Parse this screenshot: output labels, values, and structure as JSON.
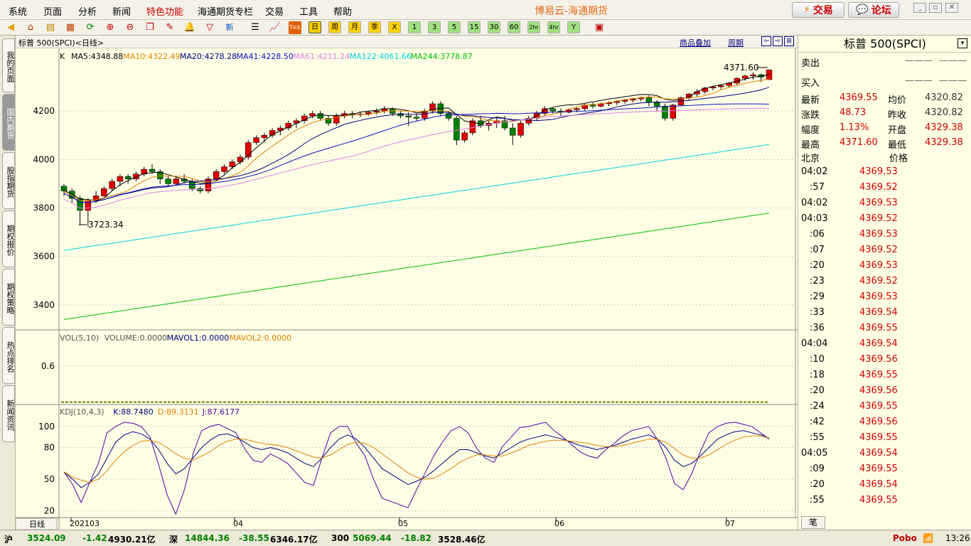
{
  "menu": [
    "系统",
    "页面",
    "分析",
    "新闻",
    "特色功能",
    "海通期货专栏",
    "交易",
    "工具",
    "帮助"
  ],
  "app_title": "博易云-海通期货",
  "buttons": {
    "trade": "交易",
    "forum": "论坛"
  },
  "toolbar_periods": [
    "日",
    "周",
    "月",
    "季",
    "X",
    "1",
    "3",
    "5",
    "15",
    "30",
    "60",
    "2hr",
    "4hr",
    "Y"
  ],
  "left_tabs": [
    "我的页面",
    "国内期货",
    "股指期货",
    "期权报价",
    "期权策略",
    "热点排名",
    "新闻资讯"
  ],
  "chart_header": {
    "title": "标普 500(SPCI)<日线>",
    "overlay_label": "商品叠加",
    "period_label": "周期"
  },
  "ma_legend": [
    {
      "label": "K",
      "color": "#000000"
    },
    {
      "label": "MA5:4348.88",
      "color": "#000000"
    },
    {
      "label": "MA10:4322.49",
      "color": "#e08000"
    },
    {
      "label": "MA20:4278.28",
      "color": "#000080"
    },
    {
      "label": "MA41:4228.50",
      "color": "#1010c0"
    },
    {
      "label": "MA61:4211.24",
      "color": "#e080e0"
    },
    {
      "label": "MA122:4061.66",
      "color": "#00d0e0"
    },
    {
      "label": "MA244:3778.87",
      "color": "#00c000"
    }
  ],
  "vol_legend": {
    "title": "VOL(5,10)",
    "volume": "VOLUME:0.0000",
    "mavol1": "MAVOL1:0.0000",
    "mavol2": "MAVOL2:0.0000"
  },
  "kdj_legend": {
    "title": "KDJ(10,4,3)",
    "k": "K:88.7480",
    "d": "D:89.3131",
    "j": "J:87.6177"
  },
  "price_annotations": {
    "high": "4371.60",
    "low": "3723.34"
  },
  "x_axis_labels": [
    {
      "label": "202103",
      "pos": "start"
    },
    {
      "label": "04",
      "pos": "apr"
    },
    {
      "label": "05",
      "pos": "may"
    },
    {
      "label": "06",
      "pos": "jun"
    },
    {
      "label": "07",
      "pos": "jul"
    }
  ],
  "x_axis_tab": "日线",
  "right_panel": {
    "title": "标普 500(SPCI)",
    "sell": {
      "label": "卖出",
      "v1": "———",
      "v2": "———"
    },
    "buy": {
      "label": "买入",
      "v1": "———",
      "v2": "———"
    },
    "quotes": [
      {
        "label": "最新",
        "value": "4369.55",
        "label2": "均价",
        "value2": "4320.82"
      },
      {
        "label": "涨跌",
        "value": "48.73",
        "label2": "昨收",
        "value2": "4320.82"
      },
      {
        "label": "幅度",
        "value": "1.13%",
        "label2": "开盘",
        "value2": "4329.38"
      },
      {
        "label": "最高",
        "value": "4371.60",
        "label2": "最低",
        "value2": "4329.38"
      }
    ],
    "ticks_header": {
      "time": "北京",
      "price": "价格"
    },
    "ticks": [
      {
        "t": "04:02",
        "p": "4369.53"
      },
      {
        "t": ":57",
        "p": "4369.52"
      },
      {
        "t": "04:02",
        "p": "4369.53"
      },
      {
        "t": "04:03",
        "p": "4369.52"
      },
      {
        "t": ":06",
        "p": "4369.53"
      },
      {
        "t": ":07",
        "p": "4369.52"
      },
      {
        "t": ":20",
        "p": "4369.53"
      },
      {
        "t": ":23",
        "p": "4369.52"
      },
      {
        "t": ":29",
        "p": "4369.53"
      },
      {
        "t": ":33",
        "p": "4369.54"
      },
      {
        "t": ":36",
        "p": "4369.55"
      },
      {
        "t": "04:04",
        "p": "4369.54"
      },
      {
        "t": ":10",
        "p": "4369.56"
      },
      {
        "t": ":18",
        "p": "4369.55"
      },
      {
        "t": ":20",
        "p": "4369.56"
      },
      {
        "t": ":24",
        "p": "4369.55"
      },
      {
        "t": ":42",
        "p": "4369.56"
      },
      {
        "t": ":55",
        "p": "4369.55"
      },
      {
        "t": "04:05",
        "p": "4369.54"
      },
      {
        "t": ":09",
        "p": "4369.55"
      },
      {
        "t": ":20",
        "p": "4369.54"
      },
      {
        "t": ":55",
        "p": "4369.55"
      }
    ],
    "bottom_tab": "笔"
  },
  "status": {
    "sh": {
      "label": "沪",
      "price": "3524.09",
      "chg": "-1.42",
      "amt": "4930.21亿"
    },
    "sz": {
      "label": "深",
      "price": "14844.36",
      "chg": "-38.55",
      "amt": "6346.17亿"
    },
    "i300": {
      "label": "300",
      "price": "5069.44",
      "chg": "-18.82",
      "amt": "3528.46亿"
    },
    "brand": "Pobo",
    "time": "13:26"
  },
  "chart_data": {
    "type": "candlestick",
    "title": "标普 500(SPCI) 日线",
    "ylim": [
      3300,
      4400
    ],
    "yticks": [
      3400,
      3600,
      3800,
      4000,
      4200
    ],
    "candles": [
      [
        3890,
        3900,
        3850,
        3870
      ],
      [
        3870,
        3880,
        3820,
        3840
      ],
      [
        3840,
        3850,
        3730,
        3790
      ],
      [
        3790,
        3840,
        3723.34,
        3830
      ],
      [
        3830,
        3870,
        3820,
        3850
      ],
      [
        3850,
        3890,
        3840,
        3880
      ],
      [
        3880,
        3920,
        3870,
        3910
      ],
      [
        3910,
        3940,
        3890,
        3930
      ],
      [
        3930,
        3940,
        3900,
        3920
      ],
      [
        3920,
        3950,
        3910,
        3940
      ],
      [
        3940,
        3970,
        3930,
        3960
      ],
      [
        3960,
        3980,
        3940,
        3950
      ],
      [
        3950,
        3960,
        3900,
        3920
      ],
      [
        3920,
        3930,
        3890,
        3900
      ],
      [
        3900,
        3930,
        3890,
        3920
      ],
      [
        3920,
        3940,
        3900,
        3910
      ],
      [
        3910,
        3920,
        3870,
        3880
      ],
      [
        3880,
        3890,
        3860,
        3870
      ],
      [
        3870,
        3930,
        3860,
        3920
      ],
      [
        3920,
        3960,
        3910,
        3950
      ],
      [
        3950,
        3980,
        3940,
        3970
      ],
      [
        3970,
        4000,
        3960,
        3990
      ],
      [
        3990,
        4020,
        3980,
        4010
      ],
      [
        4010,
        4080,
        4000,
        4070
      ],
      [
        4070,
        4100,
        4060,
        4090
      ],
      [
        4090,
        4110,
        4070,
        4100
      ],
      [
        4100,
        4130,
        4090,
        4120
      ],
      [
        4120,
        4140,
        4100,
        4130
      ],
      [
        4130,
        4160,
        4120,
        4150
      ],
      [
        4150,
        4170,
        4130,
        4160
      ],
      [
        4160,
        4190,
        4150,
        4180
      ],
      [
        4180,
        4200,
        4170,
        4190
      ],
      [
        4190,
        4200,
        4160,
        4170
      ],
      [
        4170,
        4180,
        4140,
        4150
      ],
      [
        4150,
        4190,
        4140,
        4180
      ],
      [
        4180,
        4200,
        4170,
        4190
      ],
      [
        4190,
        4200,
        4170,
        4185
      ],
      [
        4185,
        4195,
        4175,
        4188
      ],
      [
        4188,
        4200,
        4180,
        4195
      ],
      [
        4195,
        4210,
        4185,
        4200
      ],
      [
        4200,
        4220,
        4190,
        4210
      ],
      [
        4210,
        4215,
        4180,
        4190
      ],
      [
        4190,
        4200,
        4170,
        4180
      ],
      [
        4180,
        4195,
        4140,
        4175
      ],
      [
        4175,
        4190,
        4160,
        4170
      ],
      [
        4170,
        4210,
        4160,
        4200
      ],
      [
        4200,
        4240,
        4190,
        4230
      ],
      [
        4230,
        4240,
        4180,
        4190
      ],
      [
        4190,
        4200,
        4160,
        4170
      ],
      [
        4170,
        4180,
        4060,
        4080
      ],
      [
        4080,
        4120,
        4070,
        4110
      ],
      [
        4110,
        4170,
        4100,
        4160
      ],
      [
        4160,
        4180,
        4130,
        4140
      ],
      [
        4140,
        4160,
        4120,
        4150
      ],
      [
        4150,
        4170,
        4130,
        4160
      ],
      [
        4160,
        4180,
        4120,
        4130
      ],
      [
        4130,
        4150,
        4060,
        4100
      ],
      [
        4100,
        4160,
        4090,
        4150
      ],
      [
        4150,
        4180,
        4140,
        4170
      ],
      [
        4170,
        4200,
        4160,
        4190
      ],
      [
        4190,
        4220,
        4180,
        4210
      ],
      [
        4210,
        4215,
        4190,
        4200
      ],
      [
        4200,
        4210,
        4180,
        4195
      ],
      [
        4195,
        4210,
        4190,
        4205
      ],
      [
        4205,
        4215,
        4195,
        4210
      ],
      [
        4210,
        4230,
        4200,
        4225
      ],
      [
        4225,
        4235,
        4210,
        4220
      ],
      [
        4220,
        4235,
        4215,
        4230
      ],
      [
        4230,
        4240,
        4220,
        4235
      ],
      [
        4235,
        4245,
        4225,
        4240
      ],
      [
        4240,
        4250,
        4230,
        4245
      ],
      [
        4245,
        4255,
        4235,
        4250
      ],
      [
        4250,
        4260,
        4240,
        4255
      ],
      [
        4255,
        4265,
        4220,
        4235
      ],
      [
        4235,
        4245,
        4200,
        4220
      ],
      [
        4220,
        4230,
        4160,
        4170
      ],
      [
        4170,
        4230,
        4160,
        4225
      ],
      [
        4225,
        4260,
        4220,
        4255
      ],
      [
        4255,
        4275,
        4245,
        4270
      ],
      [
        4270,
        4290,
        4260,
        4280
      ],
      [
        4280,
        4300,
        4270,
        4295
      ],
      [
        4295,
        4305,
        4285,
        4300
      ],
      [
        4300,
        4310,
        4290,
        4305
      ],
      [
        4305,
        4320,
        4295,
        4315
      ],
      [
        4315,
        4340,
        4305,
        4335
      ],
      [
        4335,
        4350,
        4325,
        4345
      ],
      [
        4345,
        4360,
        4330,
        4350
      ],
      [
        4350,
        4355,
        4320,
        4340
      ],
      [
        4329.38,
        4371.6,
        4329.38,
        4369.55
      ]
    ],
    "ma_series": [
      {
        "name": "MA5",
        "color": "#000000",
        "start": 3880,
        "end": 4348.88
      },
      {
        "name": "MA10",
        "color": "#e08000",
        "start": 3860,
        "end": 4322.49
      },
      {
        "name": "MA20",
        "color": "#000080",
        "start": 3850,
        "end": 4278.28
      },
      {
        "name": "MA41",
        "color": "#1010c0",
        "start": 3850,
        "end": 4228.5
      },
      {
        "name": "MA61",
        "color": "#e080e0",
        "start": 3800,
        "end": 4211.24
      },
      {
        "name": "MA122",
        "color": "#00d0e0",
        "start": 3625,
        "end": 4061.66
      },
      {
        "name": "MA244",
        "color": "#00c000",
        "start": 3340,
        "end": 3778.87
      }
    ],
    "vol_yticks": [
      0.6
    ],
    "kdj_yticks": [
      100,
      80,
      50,
      20
    ],
    "kdj": {
      "K": [
        57,
        50,
        42,
        47,
        55,
        70,
        85,
        92,
        95,
        93,
        88,
        78,
        65,
        55,
        60,
        70,
        80,
        87,
        92,
        93,
        90,
        85,
        80,
        78,
        80,
        78,
        75,
        70,
        65,
        62,
        70,
        80,
        88,
        92,
        88,
        80,
        70,
        60,
        55,
        50,
        45,
        48,
        52,
        58,
        65,
        72,
        78,
        78,
        75,
        72,
        70,
        75,
        80,
        85,
        88,
        90,
        92,
        90,
        88,
        85,
        82,
        80,
        78,
        80,
        82,
        85,
        88,
        90,
        92,
        88,
        80,
        68,
        62,
        65,
        72,
        80,
        88,
        92,
        95,
        96,
        94,
        92,
        89
      ],
      "D": [
        57,
        52,
        49,
        47,
        50,
        58,
        68,
        76,
        82,
        86,
        87,
        85,
        80,
        74,
        70,
        68,
        72,
        76,
        82,
        86,
        88,
        88,
        86,
        84,
        83,
        82,
        80,
        77,
        74,
        71,
        70,
        73,
        78,
        83,
        85,
        84,
        80,
        74,
        68,
        62,
        56,
        52,
        50,
        51,
        55,
        60,
        66,
        70,
        73,
        73,
        72,
        72,
        75,
        78,
        82,
        84,
        86,
        87,
        87,
        86,
        85,
        84,
        82,
        81,
        81,
        82,
        84,
        86,
        88,
        88,
        85,
        79,
        73,
        70,
        70,
        73,
        78,
        83,
        87,
        90,
        91,
        91,
        89
      ],
      "J": [
        57,
        45,
        28,
        47,
        65,
        94,
        100,
        104,
        103,
        100,
        90,
        64,
        35,
        17,
        40,
        74,
        96,
        100,
        102,
        98,
        94,
        79,
        68,
        66,
        74,
        70,
        65,
        56,
        47,
        44,
        70,
        94,
        100,
        100,
        84,
        72,
        50,
        32,
        29,
        26,
        23,
        40,
        56,
        72,
        85,
        96,
        100,
        94,
        79,
        70,
        66,
        81,
        90,
        99,
        100,
        102,
        104,
        96,
        90,
        83,
        76,
        72,
        70,
        78,
        84,
        91,
        96,
        98,
        100,
        88,
        70,
        46,
        40,
        55,
        76,
        94,
        100,
        103,
        104,
        102,
        100,
        94,
        88
      ]
    }
  }
}
